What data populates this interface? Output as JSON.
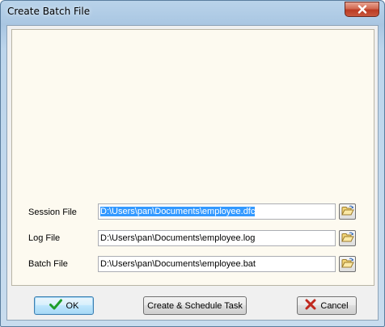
{
  "window": {
    "title": "Create Batch File"
  },
  "fields": [
    {
      "label": "Session File",
      "value": "D:\\Users\\pan\\Documents\\employee.dfc",
      "selected": true
    },
    {
      "label": "Log File",
      "value": "D:\\Users\\pan\\Documents\\employee.log",
      "selected": false
    },
    {
      "label": "Batch File",
      "value": "D:\\Users\\pan\\Documents\\employee.bat",
      "selected": false
    }
  ],
  "buttons": {
    "ok": "OK",
    "schedule": "Create & Schedule Task",
    "cancel": "Cancel"
  },
  "icons": {
    "close": "close-icon",
    "browse": "folder-open-icon",
    "ok": "checkmark-icon",
    "cancel": "x-icon"
  },
  "colors": {
    "panel_bg": "#fdfaf0",
    "selection": "#3399ff",
    "ok_check": "#1e9e2a",
    "cancel_x": "#c0281e",
    "close_button": "#c9583e"
  }
}
